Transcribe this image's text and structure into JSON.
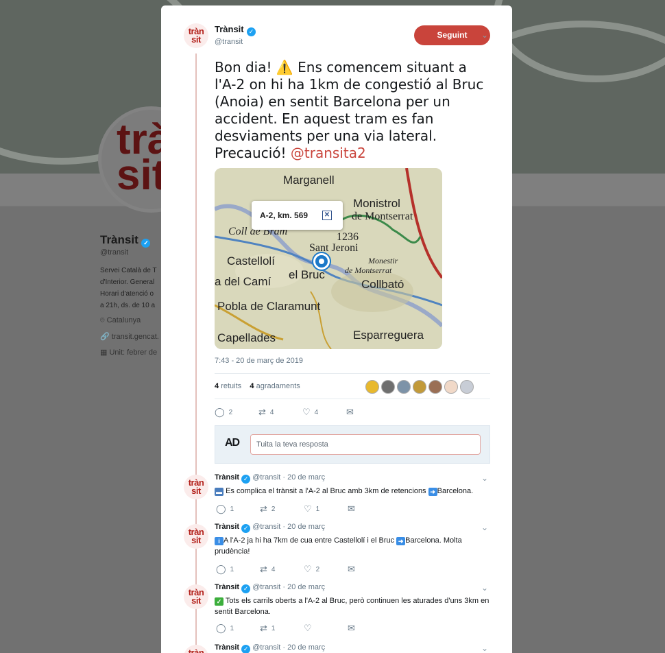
{
  "background": {
    "avatar_logo": "tràn\nsit",
    "name": "Trànsit",
    "handle": "@transit",
    "bio_lines": [
      "Servei Català de T",
      "d'Interior. General",
      "Horari d'atenció o",
      "a 21h, ds. de 10 a"
    ],
    "location": "Catalunya",
    "url": "transit.gencat.",
    "joined": "Unit: febrer de"
  },
  "tweet": {
    "avatar_logo_top": "tràn",
    "avatar_logo_bottom": "sit",
    "name": "Trànsit",
    "handle": "@transit",
    "follow_label": "Seguint",
    "text": "Bon dia! ⚠️ Ens comencem situant a l'A-2 on hi ha 1km de congestió al Bruc (Anoia) en sentit Barcelona per un accident. En aquest tram es fan desviaments per una via lateral. Precaució! ",
    "mention": "@transita2",
    "timestamp": "7:43 - 20 de març de 2019",
    "retweets_count": "4",
    "retweets_label": "retuits",
    "likes_count": "4",
    "likes_label": "agradaments",
    "reply_count": "2",
    "retweet_count": "4",
    "like_count": "4"
  },
  "map": {
    "popup_label": "A-2, km. 569",
    "places": [
      "Marganell",
      "Monistrol",
      "de Montserrat",
      "Coll de Bram",
      "1236",
      "Sant Jeroni",
      "Castellolí",
      "Monestir",
      "de Montserrat",
      "a del Camí",
      "el Bruc",
      "Collbató",
      "Pobla de Claramunt",
      "Capellades",
      "Esparreguera"
    ]
  },
  "reply_box": {
    "avatar_text": "AD",
    "placeholder": "Tuita la teva resposta"
  },
  "replies": [
    {
      "name": "Trànsit",
      "handle": "@transit",
      "date": "· 20 de març",
      "text_pre": "Es complica el trànsit a l'A-2 al Bruc amb 3km de retencions ",
      "text_post": "Barcelona.",
      "reply_count": "1",
      "retweet_count": "2",
      "like_count": "1"
    },
    {
      "name": "Trànsit",
      "handle": "@transit",
      "date": "· 20 de març",
      "text_pre": "A l'A-2 ja hi ha 7km de cua entre Castellolí i el Bruc ",
      "text_post": "Barcelona. Molta prudència!",
      "reply_count": "1",
      "retweet_count": "4",
      "like_count": "2"
    },
    {
      "name": "Trànsit",
      "handle": "@transit",
      "date": "· 20 de març",
      "text_pre": "Tots els carrils oberts a l'A-2 al Bruc, però continuen les aturades d'uns 3km en sentit Barcelona.",
      "text_post": "",
      "reply_count": "1",
      "retweet_count": "1",
      "like_count": ""
    },
    {
      "name": "Trànsit",
      "handle": "@transit",
      "date": "· 20 de març"
    }
  ],
  "colors": {
    "accent": "#c9443b",
    "verified": "#1da1f2",
    "brand": "#b3211b"
  }
}
